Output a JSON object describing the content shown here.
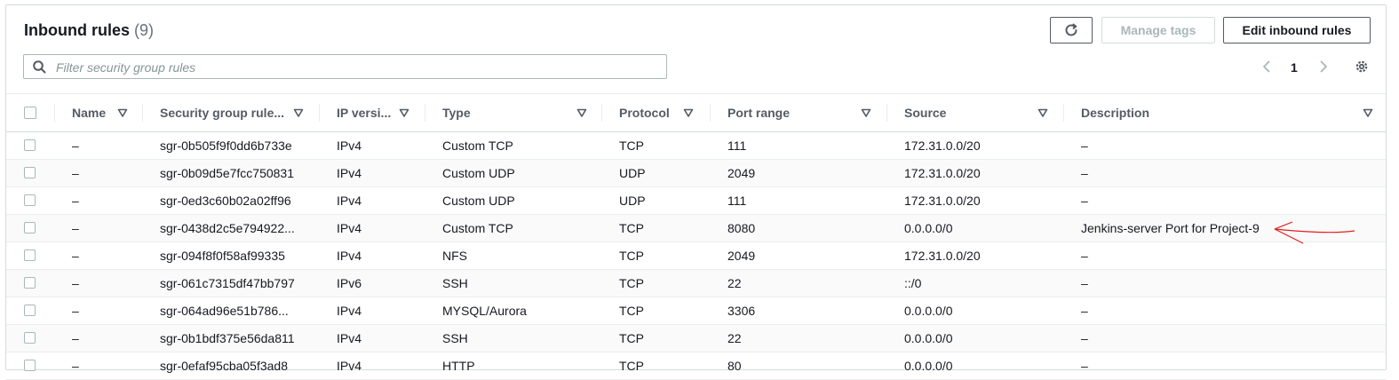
{
  "header": {
    "title": "Inbound rules",
    "count": "(9)"
  },
  "toolbar": {
    "refresh_icon": "refresh-icon",
    "manage_tags_label": "Manage tags",
    "edit_inbound_label": "Edit inbound rules"
  },
  "search": {
    "placeholder": "Filter security group rules",
    "value": ""
  },
  "pagination": {
    "current_page": "1"
  },
  "table": {
    "columns": [
      "Name",
      "Security group rule...",
      "IP versi...",
      "Type",
      "Protocol",
      "Port range",
      "Source",
      "Description"
    ],
    "rows": [
      {
        "name": "–",
        "rule_id": "sgr-0b505f9f0dd6b733e",
        "ip_version": "IPv4",
        "type": "Custom TCP",
        "protocol": "TCP",
        "port_range": "111",
        "source": "172.31.0.0/20",
        "description": "–"
      },
      {
        "name": "–",
        "rule_id": "sgr-0b09d5e7fcc750831",
        "ip_version": "IPv4",
        "type": "Custom UDP",
        "protocol": "UDP",
        "port_range": "2049",
        "source": "172.31.0.0/20",
        "description": "–"
      },
      {
        "name": "–",
        "rule_id": "sgr-0ed3c60b02a02ff96",
        "ip_version": "IPv4",
        "type": "Custom UDP",
        "protocol": "UDP",
        "port_range": "111",
        "source": "172.31.0.0/20",
        "description": "–"
      },
      {
        "name": "–",
        "rule_id": "sgr-0438d2c5e794922...",
        "ip_version": "IPv4",
        "type": "Custom TCP",
        "protocol": "TCP",
        "port_range": "8080",
        "source": "0.0.0.0/0",
        "description": "Jenkins-server Port for Project-9"
      },
      {
        "name": "–",
        "rule_id": "sgr-094f8f0f58af99335",
        "ip_version": "IPv4",
        "type": "NFS",
        "protocol": "TCP",
        "port_range": "2049",
        "source": "172.31.0.0/20",
        "description": "–"
      },
      {
        "name": "–",
        "rule_id": "sgr-061c7315df47bb797",
        "ip_version": "IPv6",
        "type": "SSH",
        "protocol": "TCP",
        "port_range": "22",
        "source": "::/0",
        "description": "–"
      },
      {
        "name": "–",
        "rule_id": "sgr-064ad96e51b786...",
        "ip_version": "IPv4",
        "type": "MYSQL/Aurora",
        "protocol": "TCP",
        "port_range": "3306",
        "source": "0.0.0.0/0",
        "description": "–"
      },
      {
        "name": "–",
        "rule_id": "sgr-0b1bdf375e56da811",
        "ip_version": "IPv4",
        "type": "SSH",
        "protocol": "TCP",
        "port_range": "22",
        "source": "0.0.0.0/0",
        "description": "–"
      },
      {
        "name": "–",
        "rule_id": "sgr-0efaf95cba05f3ad8",
        "ip_version": "IPv4",
        "type": "HTTP",
        "protocol": "TCP",
        "port_range": "80",
        "source": "0.0.0.0/0",
        "description": "–"
      }
    ]
  },
  "colors": {
    "text": "#16191f",
    "muted": "#545b64",
    "border": "#d5dbdb",
    "annotation": "#e0201f"
  }
}
